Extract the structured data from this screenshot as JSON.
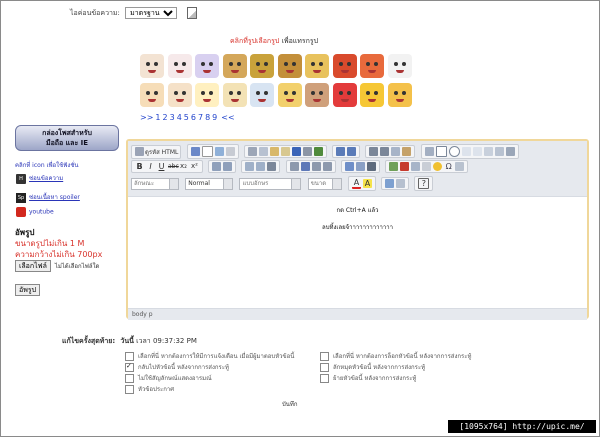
{
  "top": {
    "icon_label": "ไอค่อนข้อความ:",
    "icon_select_value": "มาตรฐาน",
    "icon_preview": "page-icon"
  },
  "smilies": {
    "heading_red": "คลิกที่รูปเลือกรูป",
    "heading_rest": " เพื่อแทรกรูป",
    "row1": [
      "#f3e3d3",
      "#f6e9ea",
      "#d8d0f0",
      "#d4a75a",
      "#c9a23b",
      "#c38f3a",
      "#e8c25d",
      "#d94a2c",
      "#e86a3c",
      "#f2f2f2"
    ],
    "row2": [
      "#f6ddb8",
      "#f5e1c8",
      "#fff0c0",
      "#f3e2b5",
      "#d8e4f2",
      "#f2d06c",
      "#cfa07b",
      "#e33b3b",
      "#f6c735",
      "#f4c14a"
    ],
    "pager_prefix": ">>",
    "pages": [
      "1",
      "2",
      "3",
      "4",
      "5",
      "6",
      "7",
      "8",
      "9"
    ],
    "pager_suffix": "<<"
  },
  "sidebar": {
    "box_title_line1": "กล่องโพสสำหรับ",
    "box_title_line2": "มือถือ และ IE",
    "icon_link": "คลิกที่ icon เพื่อใช้ฟังชั่น",
    "items": [
      {
        "label": "ซ่อนข้อความ",
        "icon": "hide-icon"
      },
      {
        "label": "ซ่อนเนื้อหา spoiler",
        "icon": "spoiler-icon"
      },
      {
        "label": "youtube",
        "icon": "youtube-icon"
      }
    ],
    "upload_title": "อัพรูป",
    "upload_limit_1": "ขนาดรูปไม่เกิน 1 M",
    "upload_limit_2": "ความกว้างไม่เกิน 700px",
    "choose_file_button": "เลือกไฟล์",
    "no_file_text": "ไม่ได้เลือกไฟล์ใด",
    "upload_button": "อัพรูป"
  },
  "editor": {
    "source_button": "ดูรหัส HTML",
    "style_combo": "ลักษณะ",
    "format_combo": "Normal",
    "font_combo": "แบบอักษร",
    "size_combo": "ขนาด",
    "body_line1": "กด Ctrl+A แล้ว",
    "body_line2": "ลบทิ้งเลยจ้าาาาาาาาาาาาา",
    "path": "body  p"
  },
  "footer": {
    "last_edit_label": "แก้ไขครั้งสุดท้าย:",
    "last_edit_date_label": "วันนี้",
    "last_edit_time": "เวลา 09:37:32 PM",
    "options_left": [
      {
        "label": "เลือกที่นี่ หากต้องการให้มีการแจ้งเตือน เมื่อมีผู้มาตอบหัวข้อนี้",
        "checked": false
      },
      {
        "label": "กลับไปหัวข้อนี้ หลังจากการส่งกระทู้",
        "checked": true
      },
      {
        "label": "ไม่ใช้สัญลักษณ์แสดงอารมณ์",
        "checked": false
      },
      {
        "label": "หัวข้อประกาศ",
        "checked": false
      }
    ],
    "options_right": [
      {
        "label": "เลือกที่นี่ หากต้องการล็อกหัวข้อนี้ หลังจากการส่งกระทู้",
        "checked": false
      },
      {
        "label": "ลักหมุดหัวข้อนี้ หลังจากการส่งกระทู้",
        "checked": false
      },
      {
        "label": "ย้ายหัวข้อนี้ หลังจากการส่งกระทู้",
        "checked": false
      }
    ],
    "save_button": "บันทึก"
  },
  "watermark": "[1095x764] http://upic.me/"
}
